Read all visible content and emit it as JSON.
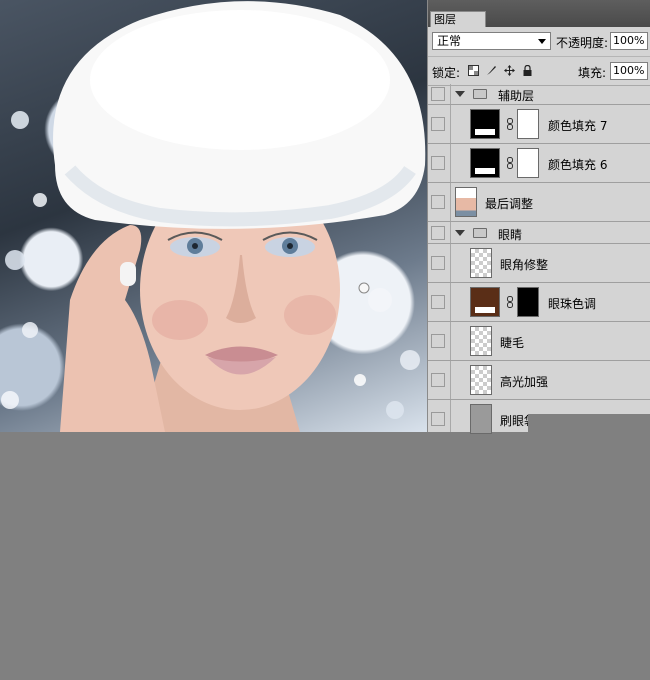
{
  "panel": {
    "tab_label": "图层",
    "blend_mode": "正常",
    "opacity_label": "不透明度:",
    "opacity_value": "100%",
    "lock_label": "锁定:",
    "fill_label": "填充:",
    "fill_value": "100%"
  },
  "layers": [
    {
      "name": "辅助层",
      "type": "group"
    },
    {
      "name": "颜色填充 7",
      "type": "fill",
      "color": "#000000"
    },
    {
      "name": "颜色填充 6",
      "type": "fill",
      "color": "#000000"
    },
    {
      "name": "最后调整",
      "type": "image"
    },
    {
      "name": "眼睛",
      "type": "group"
    },
    {
      "name": "眼角修整",
      "type": "transparent"
    },
    {
      "name": "眼珠色调",
      "type": "fill",
      "color": "#5a2e17"
    },
    {
      "name": "睫毛",
      "type": "transparent"
    },
    {
      "name": "高光加强",
      "type": "transparent"
    },
    {
      "name": "刷眼袋",
      "type": "partial"
    }
  ],
  "icons": [
    "lock-transparent-icon",
    "brush-icon",
    "move-icon",
    "lock-icon",
    "folder-icon",
    "link-chain-icon",
    "expand-triangle-icon",
    "eye-visibility-icon"
  ]
}
